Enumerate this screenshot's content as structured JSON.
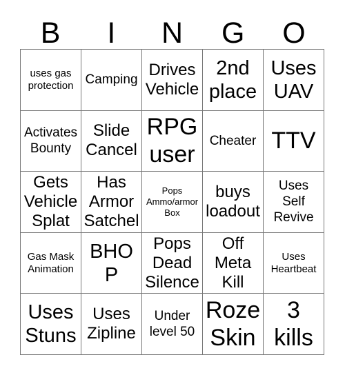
{
  "card": {
    "title": "BINGO",
    "columns": 5,
    "rows": 5,
    "border_color": "#777777",
    "text_color": "#000000",
    "background_color": "#ffffff"
  },
  "header": {
    "letters": [
      "B",
      "I",
      "N",
      "G",
      "O"
    ]
  },
  "grid": {
    "cells": [
      {
        "text": "uses gas protection",
        "size": "sm"
      },
      {
        "text": "Camping",
        "size": "md"
      },
      {
        "text": "Drives Vehicle",
        "size": "lg"
      },
      {
        "text": "2nd place",
        "size": "xl"
      },
      {
        "text": "Uses UAV",
        "size": "xl"
      },
      {
        "text": "Activates Bounty",
        "size": "md"
      },
      {
        "text": "Slide Cancel",
        "size": "lg"
      },
      {
        "text": "RPG user",
        "size": "xxl"
      },
      {
        "text": "Cheater",
        "size": "md"
      },
      {
        "text": "TTV",
        "size": "xxl"
      },
      {
        "text": "Gets Vehicle Splat",
        "size": "lg"
      },
      {
        "text": "Has Armor Satchel",
        "size": "lg"
      },
      {
        "text": "Pops Ammo/armor Box",
        "size": "xs"
      },
      {
        "text": "buys loadout",
        "size": "lg"
      },
      {
        "text": "Uses Self Revive",
        "size": "md"
      },
      {
        "text": "Gas Mask Animation",
        "size": "sm"
      },
      {
        "text": "BHOP",
        "size": "xl"
      },
      {
        "text": "Pops Dead Silence",
        "size": "lg"
      },
      {
        "text": "Off Meta Kill",
        "size": "lg"
      },
      {
        "text": "Uses Heartbeat",
        "size": "sm"
      },
      {
        "text": "Uses Stuns",
        "size": "xl"
      },
      {
        "text": "Uses Zipline",
        "size": "lg"
      },
      {
        "text": "Under level 50",
        "size": "md"
      },
      {
        "text": "Roze Skin",
        "size": "xxl"
      },
      {
        "text": "3 kills",
        "size": "xxl"
      }
    ]
  }
}
